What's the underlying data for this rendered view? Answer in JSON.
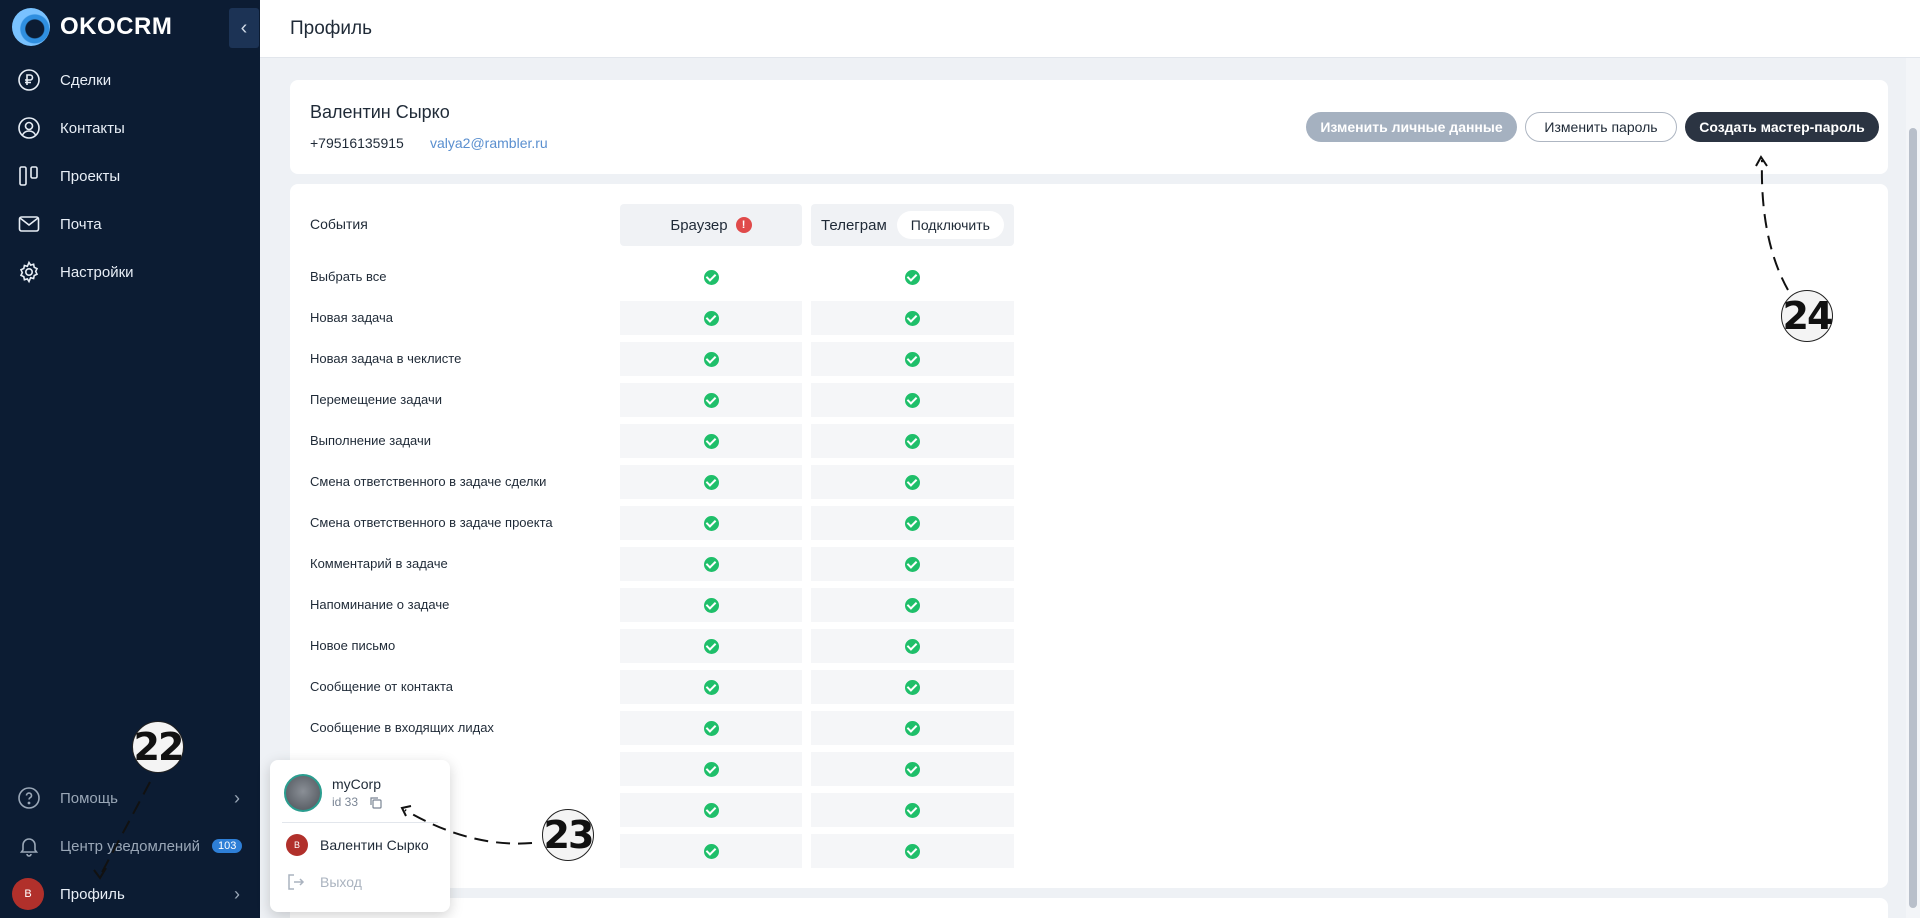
{
  "app": {
    "logo_text": "OKOCRM"
  },
  "sidebar": {
    "items": [
      {
        "label": "Сделки",
        "icon": "ruble-circle-icon"
      },
      {
        "label": "Контакты",
        "icon": "user-circle-icon"
      },
      {
        "label": "Проекты",
        "icon": "kanban-icon"
      },
      {
        "label": "Почта",
        "icon": "mail-icon"
      },
      {
        "label": "Настройки",
        "icon": "gear-icon"
      }
    ],
    "bottom": {
      "help_label": "Помощь",
      "notifications_label": "Центр уведомлений",
      "notifications_count": "103",
      "profile_label": "Профиль",
      "profile_initial": "В"
    }
  },
  "header": {
    "title": "Профиль"
  },
  "profile": {
    "name": "Валентин Сырко",
    "phone": "+79516135915",
    "email": "valya2@rambler.ru",
    "buttons": {
      "edit_personal": "Изменить личные данные",
      "change_password": "Изменить пароль",
      "create_master_password": "Создать мастер-пароль"
    }
  },
  "events": {
    "header_label": "События",
    "columns": {
      "browser": "Браузер",
      "telegram": "Телеграм",
      "connect": "Подключить",
      "warning": "!"
    },
    "rows": [
      "Выбрать все",
      "Новая задача",
      "Новая задача в чеклисте",
      "Перемещение задачи",
      "Выполнение задачи",
      "Смена ответственного в задаче сделки",
      "Смена ответственного в задаче проекта",
      "Комментарий в задаче",
      "Напоминание о задаче",
      "Новое письмо",
      "Сообщение от контакта",
      "Сообщение в входящих лидах",
      "",
      "",
      ""
    ]
  },
  "popup": {
    "org_name": "myCorp",
    "org_id": "id 33",
    "user_name": "Валентин Сырко",
    "user_initial": "В",
    "exit_label": "Выход"
  },
  "annotations": {
    "a22": "22",
    "a23": "23",
    "a24": "24"
  }
}
